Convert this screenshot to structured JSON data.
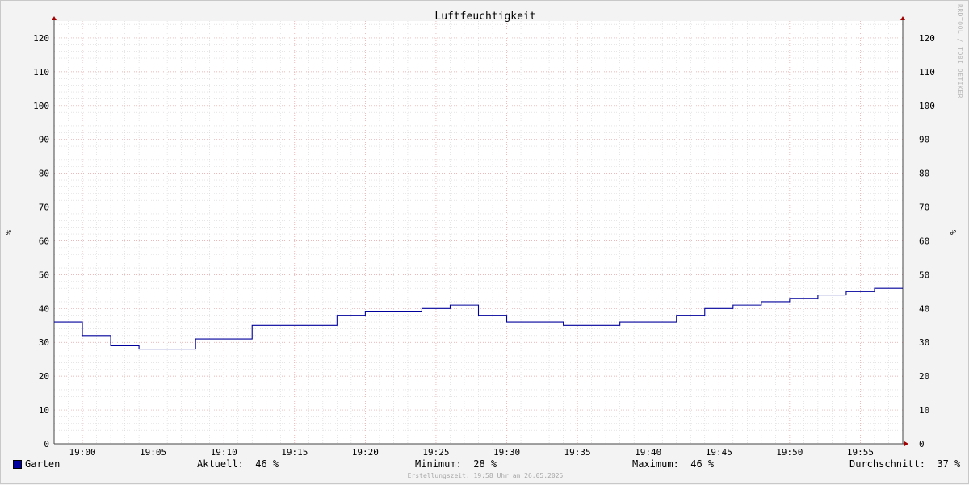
{
  "chart_data": {
    "type": "line",
    "title": "Luftfeuchtigkeit",
    "ylabel_left": "%",
    "ylabel_right": "%",
    "ylim": [
      0,
      125
    ],
    "yticks": [
      0,
      10,
      20,
      30,
      40,
      50,
      60,
      70,
      80,
      90,
      100,
      110,
      120
    ],
    "xlim": [
      "18:58",
      "19:58"
    ],
    "xticks": [
      "19:00",
      "19:05",
      "19:10",
      "19:15",
      "19:20",
      "19:25",
      "19:30",
      "19:35",
      "19:40",
      "19:45",
      "19:50",
      "19:55"
    ],
    "grid": true,
    "series": [
      {
        "name": "Garten",
        "color": "#00009c",
        "step": true,
        "x": [
          "18:58",
          "19:00",
          "19:02",
          "19:04",
          "19:08",
          "19:12",
          "19:18",
          "19:20",
          "19:22",
          "19:24",
          "19:26",
          "19:28",
          "19:30",
          "19:34",
          "19:38",
          "19:42",
          "19:44",
          "19:46",
          "19:48",
          "19:50",
          "19:52",
          "19:54",
          "19:56"
        ],
        "y": [
          36,
          32,
          29,
          28,
          31,
          35,
          38,
          39,
          39,
          40,
          41,
          38,
          36,
          35,
          36,
          38,
          40,
          41,
          42,
          43,
          44,
          45,
          46
        ],
        "end": "19:58"
      }
    ]
  },
  "legend": {
    "series_name": "Garten",
    "current_label": "Aktuell:",
    "current_value": "46 %",
    "min_label": "Minimum:",
    "min_value": "28 %",
    "max_label": "Maximum:",
    "max_value": "46 %",
    "avg_label": "Durchschnitt:",
    "avg_value": "37 %"
  },
  "footer": "Erstellungszeit: 19:58 Uhr am 26.05.2025",
  "watermark": "RRDTOOL / TOBI OETIKER",
  "colors": {
    "background": "#f3f3f3",
    "plot_background": "#ffffff",
    "major_grid": "#e6a0a0",
    "minor_grid": "#d6d6d6",
    "line": "#00009c",
    "axis": "#444444",
    "arrow": "#a00000"
  }
}
